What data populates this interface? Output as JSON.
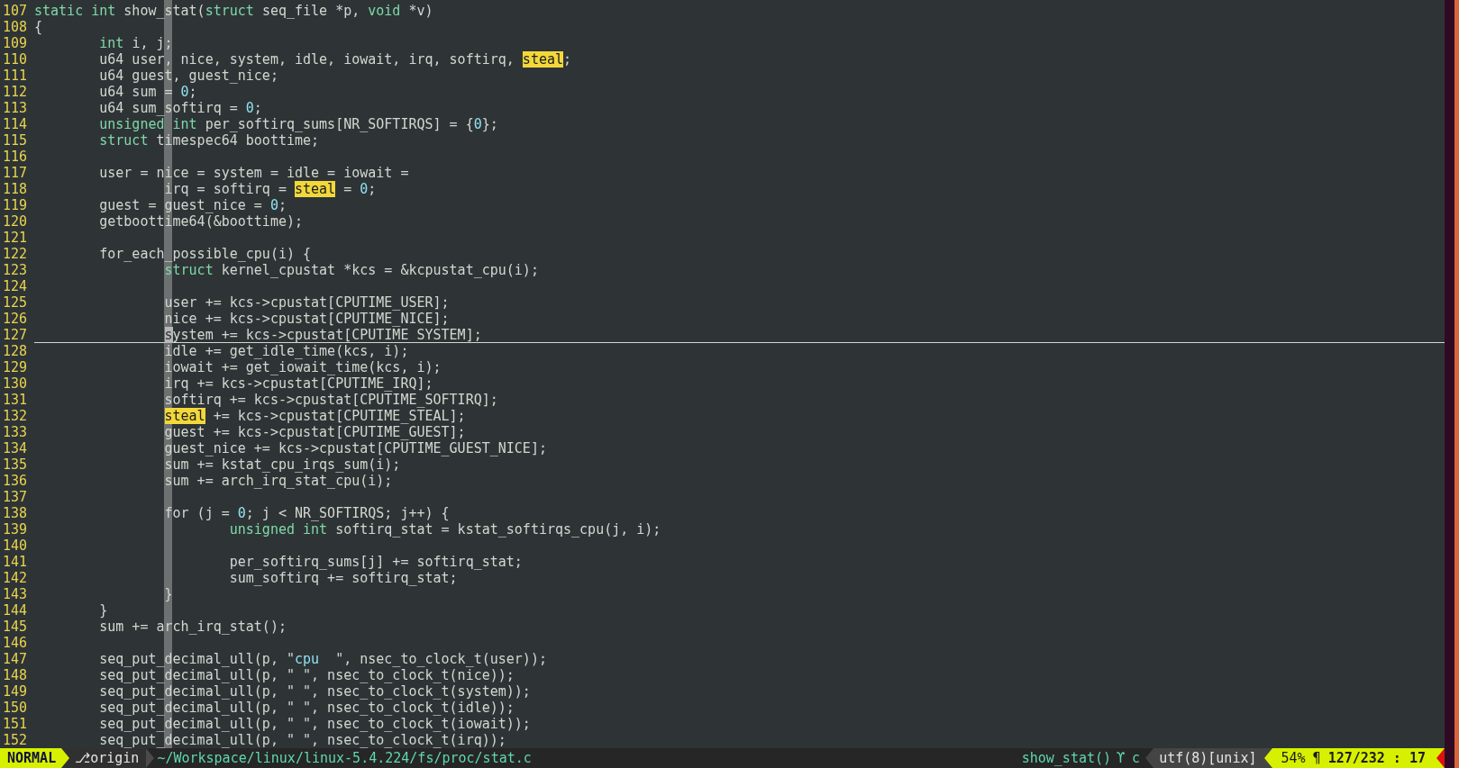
{
  "editor": {
    "lines": [
      {
        "number": "107",
        "segments": [
          {
            "kind": "keyword",
            "text": "static int"
          },
          {
            "kind": "plain",
            "text": " show_stat("
          },
          {
            "kind": "keyword",
            "text": "struct"
          },
          {
            "kind": "plain",
            "text": " seq_file *p, "
          },
          {
            "kind": "keyword",
            "text": "void"
          },
          {
            "kind": "plain",
            "text": " *v)"
          }
        ]
      },
      {
        "number": "108",
        "segments": [
          {
            "kind": "plain",
            "text": "{"
          }
        ]
      },
      {
        "number": "109",
        "segments": [
          {
            "kind": "keyword",
            "text": "        int"
          },
          {
            "kind": "plain",
            "text": " i, j;"
          }
        ]
      },
      {
        "number": "110",
        "segments": [
          {
            "kind": "plain",
            "text": "        u64 user, nice, system, idle, iowait, irq, softirq, "
          },
          {
            "kind": "search",
            "text": "steal"
          },
          {
            "kind": "plain",
            "text": ";"
          }
        ]
      },
      {
        "number": "111",
        "segments": [
          {
            "kind": "plain",
            "text": "        u64 guest, guest_nice;"
          }
        ]
      },
      {
        "number": "112",
        "segments": [
          {
            "kind": "plain",
            "text": "        u64 sum = "
          },
          {
            "kind": "number",
            "text": "0"
          },
          {
            "kind": "plain",
            "text": ";"
          }
        ]
      },
      {
        "number": "113",
        "segments": [
          {
            "kind": "plain",
            "text": "        u64 sum_softirq = "
          },
          {
            "kind": "number",
            "text": "0"
          },
          {
            "kind": "plain",
            "text": ";"
          }
        ]
      },
      {
        "number": "114",
        "segments": [
          {
            "kind": "keyword",
            "text": "        unsigned int"
          },
          {
            "kind": "plain",
            "text": " per_softirq_sums[NR_SOFTIRQS] = {"
          },
          {
            "kind": "number",
            "text": "0"
          },
          {
            "kind": "plain",
            "text": "};"
          }
        ]
      },
      {
        "number": "115",
        "segments": [
          {
            "kind": "keyword",
            "text": "        struct"
          },
          {
            "kind": "plain",
            "text": " timespec64 boottime;"
          }
        ]
      },
      {
        "number": "116"
      },
      {
        "number": "117",
        "segments": [
          {
            "kind": "plain",
            "text": "        user = nice = system = idle = iowait ="
          }
        ]
      },
      {
        "number": "118",
        "segments": [
          {
            "kind": "plain",
            "text": "                irq = softirq = "
          },
          {
            "kind": "search",
            "text": "steal"
          },
          {
            "kind": "plain",
            "text": " = "
          },
          {
            "kind": "number",
            "text": "0"
          },
          {
            "kind": "plain",
            "text": ";"
          }
        ]
      },
      {
        "number": "119",
        "segments": [
          {
            "kind": "plain",
            "text": "        guest = guest_nice = "
          },
          {
            "kind": "number",
            "text": "0"
          },
          {
            "kind": "plain",
            "text": ";"
          }
        ]
      },
      {
        "number": "120",
        "segments": [
          {
            "kind": "plain",
            "text": "        getboottime64(&boottime);"
          }
        ]
      },
      {
        "number": "121"
      },
      {
        "number": "122",
        "segments": [
          {
            "kind": "plain",
            "text": "        for_each_possible_cpu(i) {"
          }
        ]
      },
      {
        "number": "123",
        "segments": [
          {
            "kind": "keyword",
            "text": "                struct"
          },
          {
            "kind": "plain",
            "text": " kernel_cpustat *kcs = &kcpustat_cpu(i);"
          }
        ]
      },
      {
        "number": "124"
      },
      {
        "number": "125",
        "segments": [
          {
            "kind": "plain",
            "text": "                user += kcs->cpustat[CPUTIME_USER];"
          }
        ]
      },
      {
        "number": "126",
        "segments": [
          {
            "kind": "plain",
            "text": "                nice += kcs->cpustat[CPUTIME_NICE];"
          }
        ]
      },
      {
        "number": "127",
        "segments": [
          {
            "kind": "cursor",
            "text": "                s"
          },
          {
            "kind": "plain",
            "text": "ystem += kcs->cpustat[CPUTIME_SYSTEM];"
          }
        ]
      },
      {
        "number": "128",
        "segments": [
          {
            "kind": "plain",
            "text": "                idle += get_idle_time(kcs, i);"
          }
        ]
      },
      {
        "number": "129",
        "segments": [
          {
            "kind": "plain",
            "text": "                iowait += get_iowait_time(kcs, i);"
          }
        ]
      },
      {
        "number": "130",
        "segments": [
          {
            "kind": "plain",
            "text": "                irq += kcs->cpustat[CPUTIME_IRQ];"
          }
        ]
      },
      {
        "number": "131",
        "segments": [
          {
            "kind": "plain",
            "text": "                softirq += kcs->cpustat[CPUTIME_SOFTIRQ];"
          }
        ]
      },
      {
        "number": "132",
        "segments": [
          {
            "kind": "search",
            "text": "                steal"
          },
          {
            "kind": "plain",
            "text": " += kcs->cpustat[CPUTIME_STEAL];"
          }
        ]
      },
      {
        "number": "133",
        "segments": [
          {
            "kind": "plain",
            "text": "                guest += kcs->cpustat[CPUTIME_GUEST];"
          }
        ]
      },
      {
        "number": "134",
        "segments": [
          {
            "kind": "plain",
            "text": "                guest_nice += kcs->cpustat[CPUTIME_GUEST_NICE];"
          }
        ]
      },
      {
        "number": "135",
        "segments": [
          {
            "kind": "plain",
            "text": "                sum += kstat_cpu_irqs_sum(i);"
          }
        ]
      },
      {
        "number": "136",
        "segments": [
          {
            "kind": "plain",
            "text": "                sum += arch_irq_stat_cpu(i);"
          }
        ]
      },
      {
        "number": "137"
      },
      {
        "number": "138",
        "segments": [
          {
            "kind": "plain",
            "text": "                for (j = "
          },
          {
            "kind": "number",
            "text": "0"
          },
          {
            "kind": "plain",
            "text": "; j < NR_SOFTIRQS; j++) {"
          }
        ]
      },
      {
        "number": "139",
        "segments": [
          {
            "kind": "keyword",
            "text": "                        unsigned int"
          },
          {
            "kind": "plain",
            "text": " softirq_stat = kstat_softirqs_cpu(j, i);"
          }
        ]
      },
      {
        "number": "140"
      },
      {
        "number": "141",
        "segments": [
          {
            "kind": "plain",
            "text": "                        per_softirq_sums[j] += softirq_stat;"
          }
        ]
      },
      {
        "number": "142",
        "segments": [
          {
            "kind": "plain",
            "text": "                        sum_softirq += softirq_stat;"
          }
        ]
      },
      {
        "number": "143",
        "segments": [
          {
            "kind": "plain",
            "text": "                }"
          }
        ]
      },
      {
        "number": "144",
        "segments": [
          {
            "kind": "plain",
            "text": "        }"
          }
        ]
      },
      {
        "number": "145",
        "segments": [
          {
            "kind": "plain",
            "text": "        sum += arch_irq_stat();"
          }
        ]
      },
      {
        "number": "146"
      },
      {
        "number": "147",
        "segments": [
          {
            "kind": "plain",
            "text": "        seq_put_decimal_ull(p, \""
          },
          {
            "kind": "number",
            "text": "cpu"
          },
          {
            "kind": "plain",
            "text": "  \", nsec_to_clock_t(user));"
          }
        ]
      },
      {
        "number": "148",
        "segments": [
          {
            "kind": "plain",
            "text": "        seq_put_decimal_ull(p, \" \", nsec_to_clock_t(nice));"
          }
        ]
      },
      {
        "number": "149",
        "segments": [
          {
            "kind": "plain",
            "text": "        seq_put_decimal_ull(p, \" \", nsec_to_clock_t(system));"
          }
        ]
      },
      {
        "number": "150",
        "segments": [
          {
            "kind": "plain",
            "text": "        seq_put_decimal_ull(p, \" \", nsec_to_clock_t(idle));"
          }
        ]
      },
      {
        "number": "151",
        "segments": [
          {
            "kind": "plain",
            "text": "        seq_put_decimal_ull(p, \" \", nsec_to_clock_t(iowait));"
          }
        ]
      },
      {
        "number": "152",
        "segments": [
          {
            "kind": "plain",
            "text": "        seq_put_decimal_ull(p, \" \", nsec_to_clock_t(irq));"
          }
        ]
      }
    ]
  },
  "status_bar": {
    "mode": "NORMAL",
    "branch": "⎇origin",
    "file_path": "~/Workspace/linux/linux-5.4.224/fs/proc/stat.c",
    "function": "show_stat()",
    "tag_symbol": "ϒ",
    "filetype": "c",
    "encoding": "utf(8)[unix]",
    "percent": "54%",
    "line_symbol": "¶",
    "position": "127/232 : 17"
  }
}
